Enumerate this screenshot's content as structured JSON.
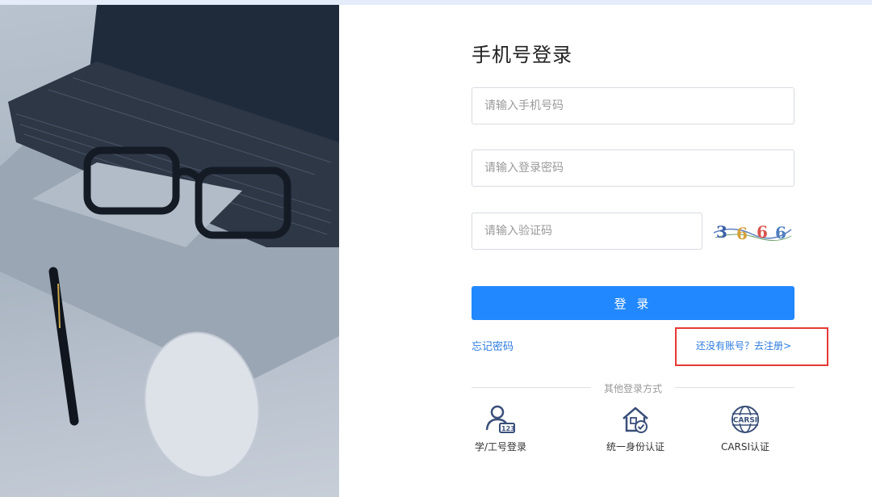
{
  "login": {
    "title": "手机号登录",
    "phone_placeholder": "请输入手机号码",
    "password_placeholder": "请输入登录密码",
    "captcha_placeholder": "请输入验证码",
    "captcha_text": "3 6 6 6",
    "login_button": "登 录",
    "forgot_password": "忘记密码",
    "register_link": "还没有账号？去注册>",
    "other_methods_label": "其他登录方式",
    "other_methods": [
      {
        "label": "学/工号登录",
        "icon": "user-id-icon"
      },
      {
        "label": "统一身份认证",
        "icon": "home-shield-icon"
      },
      {
        "label": "CARSI认证",
        "icon": "carsi-globe-icon"
      }
    ]
  },
  "colors": {
    "primary": "#2288ff",
    "link": "#2b7be0",
    "highlight_border": "#e53935",
    "icon": "#3a4f7a"
  }
}
